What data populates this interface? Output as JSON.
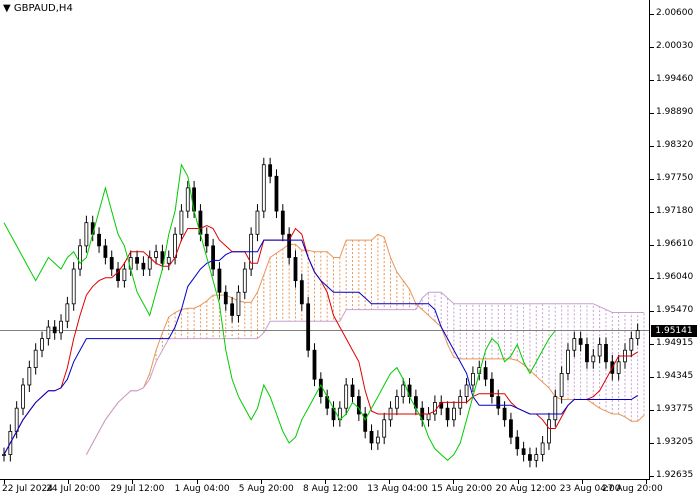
{
  "window": {
    "symbol": "GBPAUD,H4",
    "current_price": "1.95141"
  },
  "chart_data": {
    "type": "candlestick",
    "symbol": "GBPAUD",
    "timeframe": "H4",
    "ylim": [
      1.9263,
      2.006
    ],
    "y_ticks": [
      "2.00600",
      "2.00030",
      "1.99460",
      "1.98890",
      "1.98320",
      "1.97750",
      "1.97180",
      "1.96610",
      "1.96040",
      "1.95470",
      "1.94915",
      "1.94345",
      "1.93775",
      "1.93205",
      "1.92635"
    ],
    "x_ticks": [
      "22 Jul 2024",
      "24 Jul 20:00",
      "29 Jul 12:00",
      "1 Aug 04:00",
      "5 Aug 20:00",
      "8 Aug 12:00",
      "13 Aug 04:00",
      "15 Aug 20:00",
      "20 Aug 12:00",
      "23 Aug 04:00",
      "27 Aug 20:00"
    ],
    "current_price": 1.95141,
    "colors": {
      "candle": "#000000",
      "tenkan": "#e00000",
      "kijun": "#0000c8",
      "chikou": "#00cc00",
      "cloud_bull": "#e8965a",
      "cloud_bear": "#c8a0d2",
      "price_line": "#808080"
    },
    "close": [
      1.93,
      1.934,
      1.938,
      1.942,
      1.945,
      1.948,
      1.95,
      1.952,
      1.951,
      1.953,
      1.956,
      1.962,
      1.966,
      1.97,
      1.968,
      1.966,
      1.964,
      1.962,
      1.96,
      1.962,
      1.964,
      1.963,
      1.962,
      1.964,
      1.965,
      1.963,
      1.964,
      1.968,
      1.972,
      1.976,
      1.972,
      1.968,
      1.966,
      1.962,
      1.958,
      1.956,
      1.954,
      1.958,
      1.962,
      1.968,
      1.972,
      1.98,
      1.978,
      1.972,
      1.968,
      1.964,
      1.96,
      1.956,
      1.948,
      1.943,
      1.94,
      1.938,
      1.936,
      1.938,
      1.942,
      1.94,
      1.937,
      1.934,
      1.932,
      1.933,
      1.936,
      1.938,
      1.94,
      1.942,
      1.94,
      1.938,
      1.936,
      1.937,
      1.939,
      1.938,
      1.936,
      1.938,
      1.94,
      1.942,
      1.944,
      1.945,
      1.943,
      1.94,
      1.938,
      1.936,
      1.933,
      1.931,
      1.93,
      1.929,
      1.93,
      1.932,
      1.936,
      1.94,
      1.944,
      1.948,
      1.95,
      1.949,
      1.946,
      1.947,
      1.949,
      1.946,
      1.944,
      1.946,
      1.948,
      1.95,
      1.9514
    ]
  }
}
